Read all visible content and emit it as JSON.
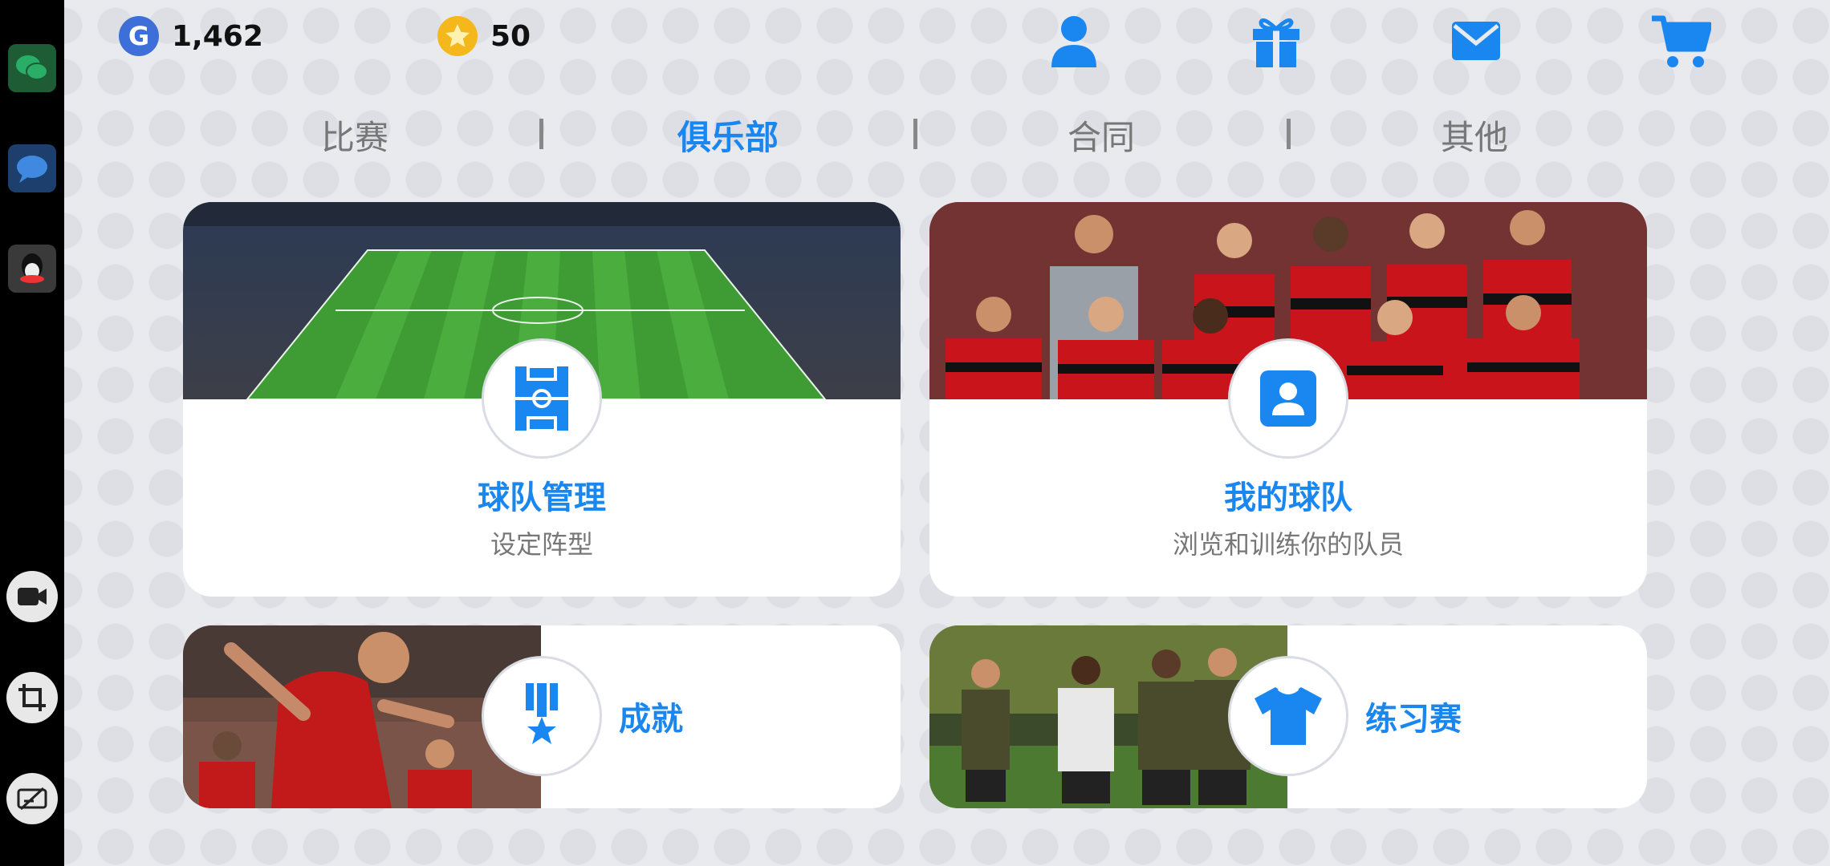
{
  "sysbar": {
    "apps": [
      {
        "name": "wechat-icon",
        "color": "#2aae67"
      },
      {
        "name": "message-icon",
        "color": "#3f8ae0"
      },
      {
        "name": "qq-icon",
        "color": "#5a5a5a"
      }
    ],
    "tools": [
      "video-record-icon",
      "crop-icon",
      "edit-off-icon"
    ]
  },
  "currency": {
    "gp": {
      "icon": "G",
      "value": "1,462"
    },
    "coins": {
      "value": "50"
    }
  },
  "tabs": [
    {
      "label": "比赛",
      "active": false
    },
    {
      "label": "俱乐部",
      "active": true
    },
    {
      "label": "合同",
      "active": false
    },
    {
      "label": "其他",
      "active": false
    }
  ],
  "cards": {
    "team_management": {
      "title": "球队管理",
      "subtitle": "设定阵型"
    },
    "my_team": {
      "title": "我的球队",
      "subtitle": "浏览和训练你的队员"
    },
    "achievements": {
      "title": "成就"
    },
    "practice": {
      "title": "练习赛"
    }
  },
  "colors": {
    "accent": "#1a86f0",
    "coin_gold": "#f4b81c",
    "gp_blue": "#3e6fd8"
  }
}
